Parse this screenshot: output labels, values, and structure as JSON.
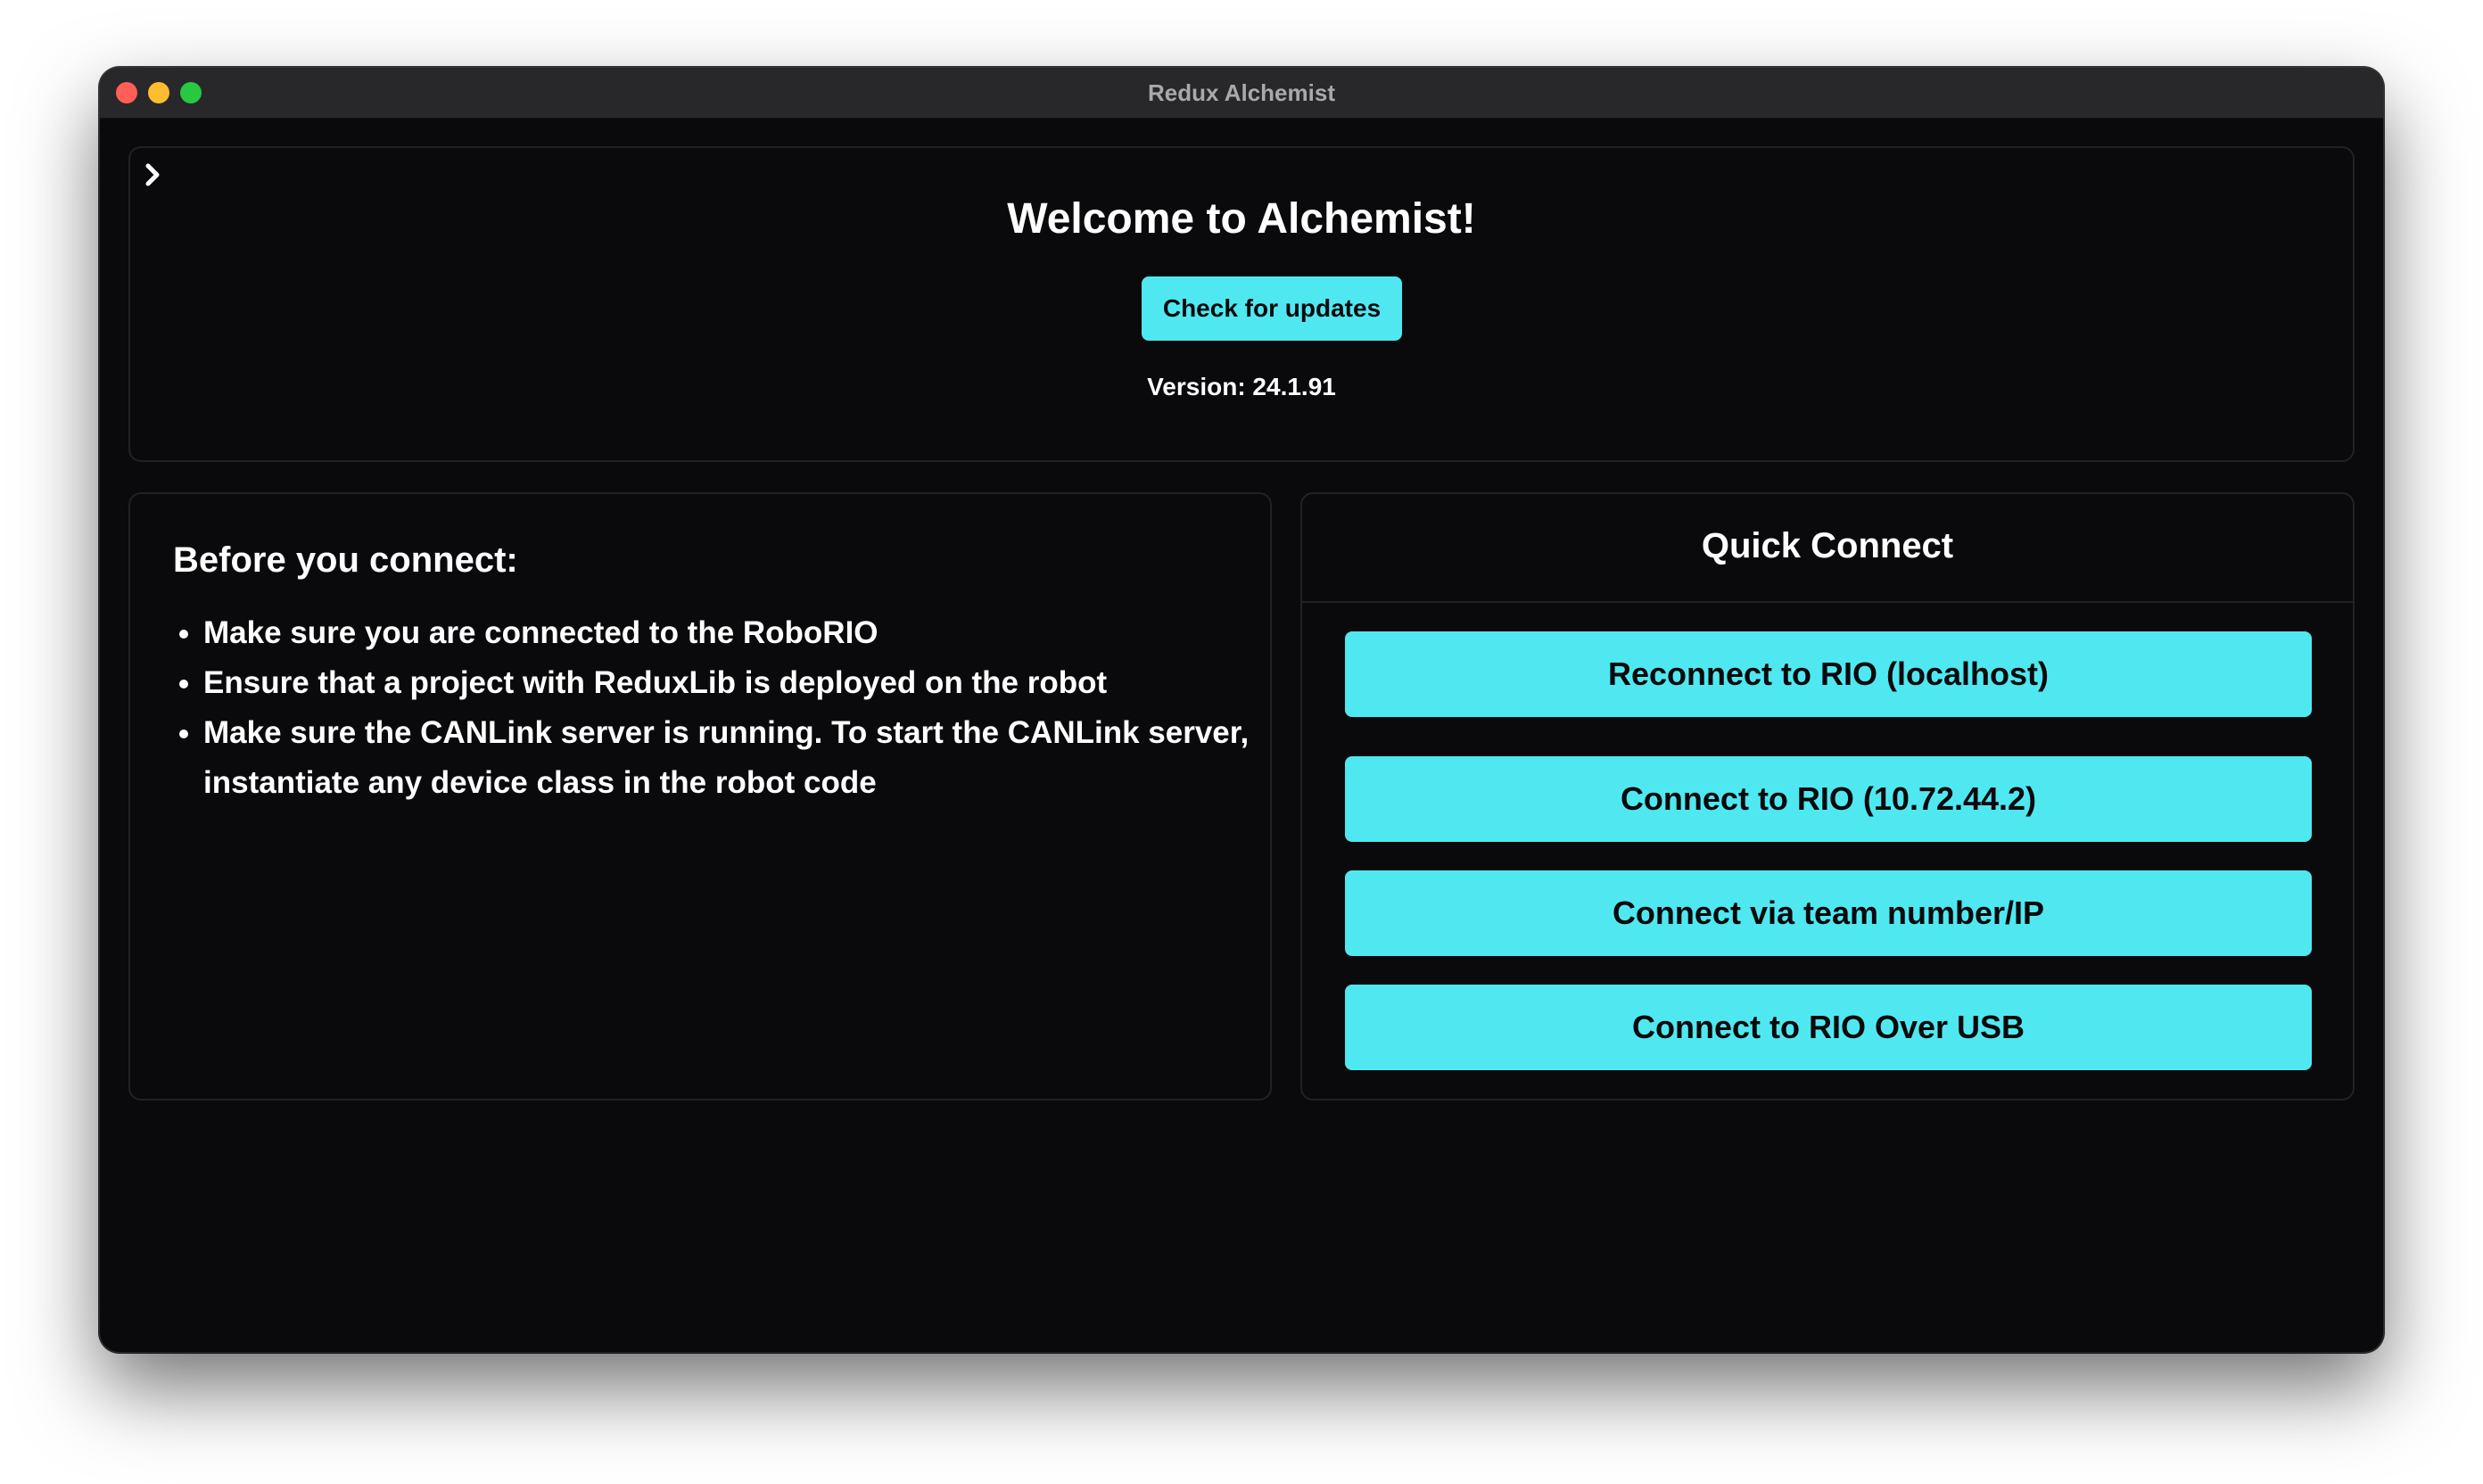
{
  "window": {
    "title": "Redux Alchemist"
  },
  "welcome": {
    "title": "Welcome to Alchemist!",
    "update_button": "Check for updates",
    "version": "Version: 24.1.91",
    "expand_icon": "chevron-right-icon"
  },
  "before_connect": {
    "title": "Before you connect:",
    "items": [
      "Make sure you are connected to the RoboRIO",
      "Ensure that a project with ReduxLib is deployed on the robot",
      "Make sure the CANLink server is running. To start the CANLink server, instantiate any device class in the robot code"
    ]
  },
  "quick_connect": {
    "title": "Quick Connect",
    "buttons": [
      "Reconnect to RIO (localhost)",
      "Connect to RIO (10.72.44.2)",
      "Connect via team number/IP",
      "Connect to RIO Over USB"
    ]
  },
  "colors": {
    "accent": "#50e8f0",
    "background": "#0a0a0c",
    "titlebar": "#28282b",
    "close": "#ff5f57",
    "minimize": "#febc2e",
    "zoom": "#28c840"
  }
}
